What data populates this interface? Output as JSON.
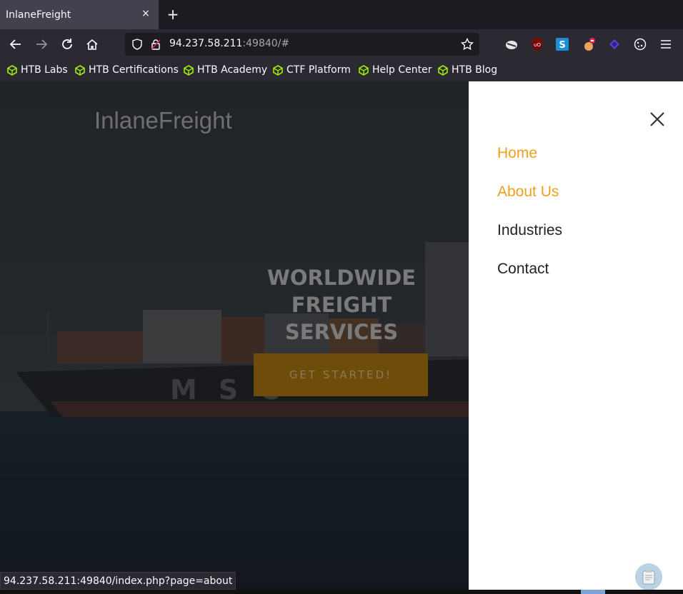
{
  "browser": {
    "tab_title": "InlaneFreight",
    "tab_close": "×",
    "new_tab": "+",
    "url_host": "94.237.58.211",
    "url_rest": ":49840/#",
    "status_url": "94.237.58.211:49840/index.php?page=about"
  },
  "bookmarks": [
    "HTB Labs",
    "HTB Certifications",
    "HTB Academy",
    "CTF Platform",
    "Help Center",
    "HTB Blog"
  ],
  "page": {
    "logo": "InlaneFreight",
    "headline_line1": "WORLDWIDE FREIGHT",
    "headline_line2": "SERVICES",
    "cta": "GET STARTED!",
    "ship_lettering": "MSC"
  },
  "menu": {
    "items": [
      "Home",
      "About Us",
      "Industries",
      "Contact"
    ],
    "active_color": "#f0a020"
  },
  "colors": {
    "accent": "#f0a020",
    "bookmark_icon": "#9fef00"
  }
}
